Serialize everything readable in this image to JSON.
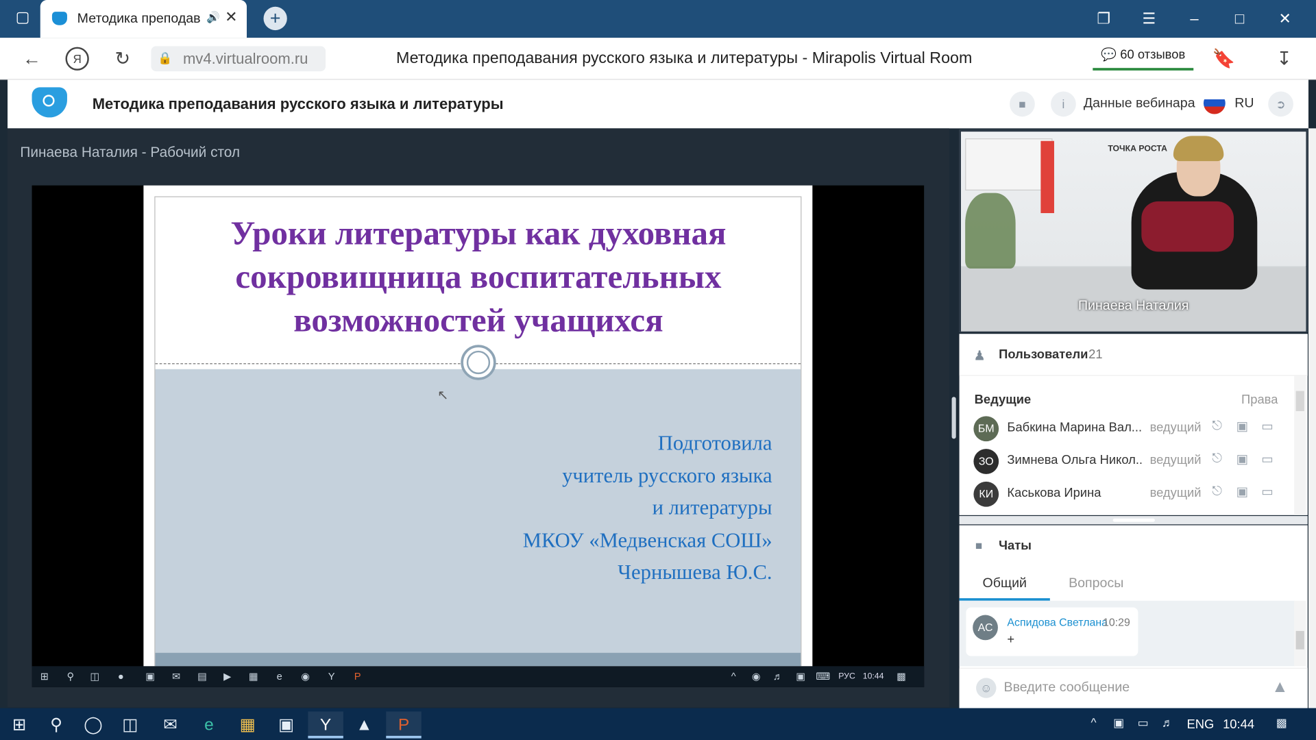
{
  "browser": {
    "tab_title": "Методика преподав",
    "address": "mv4.virtualroom.ru",
    "page_title": "Методика преподавания русского языка и литературы - Mirapolis Virtual Room",
    "reviews": "60 отзывов"
  },
  "app": {
    "title": "Методика преподавания русского языка и литературы",
    "webinar_info": "Данные вебинара",
    "lang": "RU"
  },
  "share": {
    "title": "Пинаева Наталия - Рабочий стол",
    "slide_heading": "Уроки литературы как духовная сокровищница воспитательных возможностей учащихся",
    "slide_lines": [
      "Подготовила",
      "учитель русского языка",
      "и литературы",
      "МКОУ «Медвенская СОШ»",
      "Чернышева Ю.С."
    ],
    "inner_lang": "РУС",
    "inner_time": "10:44"
  },
  "video": {
    "name": "Пинаева Наталия",
    "sign_text": "ТОЧКА РОСТА"
  },
  "users": {
    "label": "Пользователи",
    "count": "21",
    "section": "Ведущие",
    "rights_label": "Права",
    "list": [
      {
        "initials": "БМ",
        "name": "Бабкина Марина Вал...",
        "role": "ведущий",
        "color": "#5d6b55"
      },
      {
        "initials": "ЗО",
        "name": "Зимнева Ольга Никол...",
        "role": "ведущий",
        "color": "#2d2d2d"
      },
      {
        "initials": "КИ",
        "name": "Каськова Ирина",
        "role": "ведущий",
        "color": "#3b3b3b"
      }
    ]
  },
  "chat": {
    "label": "Чаты",
    "tabs": [
      "Общий",
      "Вопросы"
    ],
    "messages": [
      {
        "initials": "АС",
        "author": "Аспидова Светлана",
        "time": "10:29",
        "text": "+"
      }
    ],
    "placeholder": "Введите сообщение"
  },
  "taskbar": {
    "lang": "ENG",
    "time": "10:44"
  },
  "colors": {
    "accent": "#1a8fd0",
    "heading": "#7030a0",
    "subtext": "#1f6fc0",
    "taskbar": "#0b2b4d",
    "tabbar": "#1f4e79"
  }
}
